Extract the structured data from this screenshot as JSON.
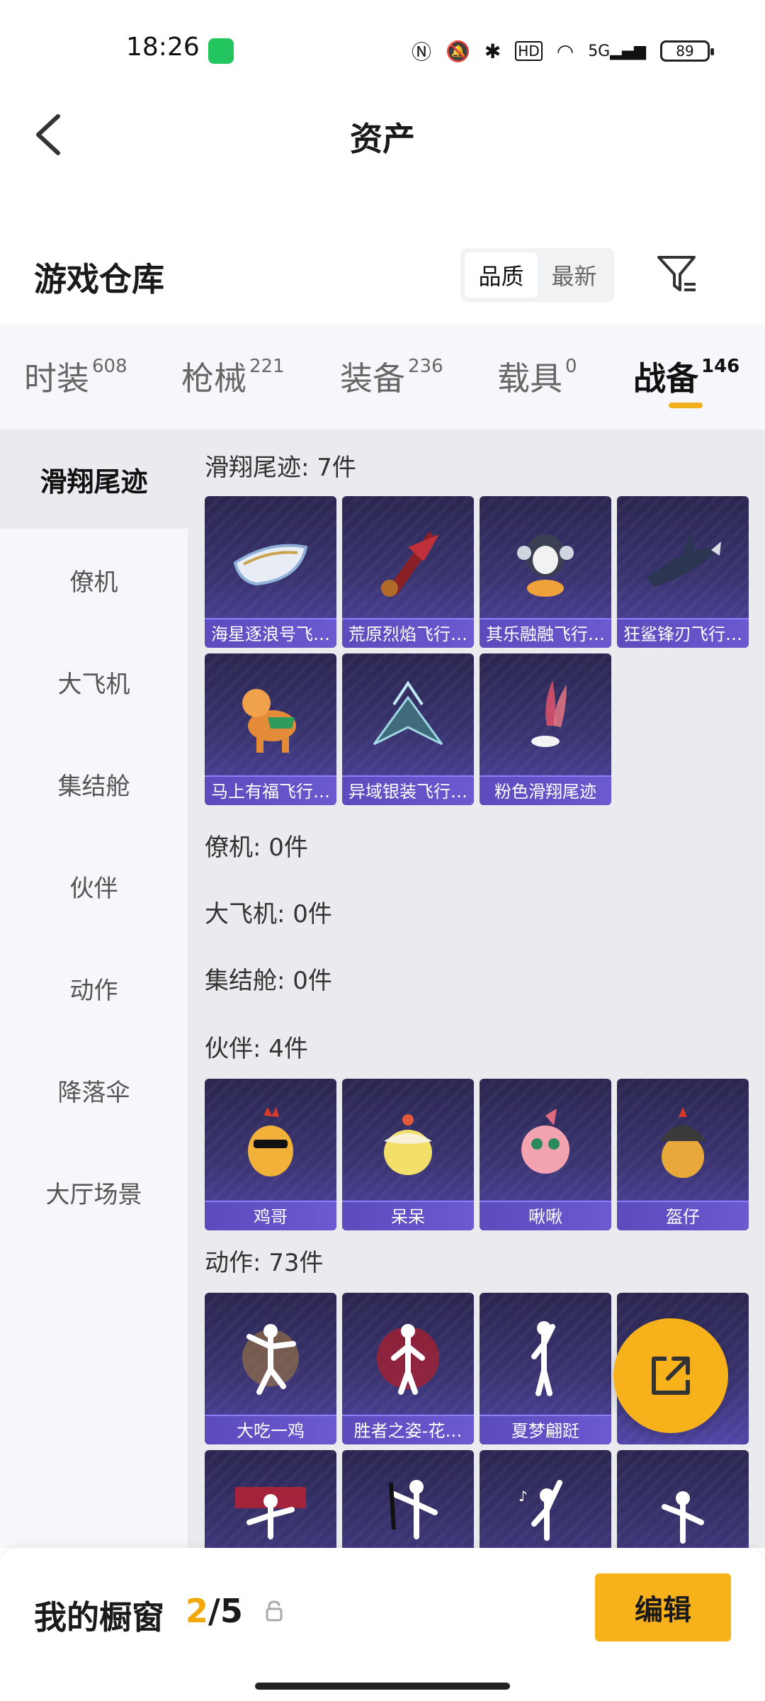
{
  "status_bar": {
    "time": "18:26",
    "battery": "89",
    "network": "5G"
  },
  "header": {
    "title": "资产"
  },
  "warehouse": {
    "title": "游戏仓库",
    "sort_options": [
      "品质",
      "最新"
    ],
    "active_sort": "品质"
  },
  "category_tabs": [
    {
      "label": "时装",
      "count": "608"
    },
    {
      "label": "枪械",
      "count": "221"
    },
    {
      "label": "装备",
      "count": "236"
    },
    {
      "label": "载具",
      "count": "0"
    },
    {
      "label": "战备",
      "count": "146"
    }
  ],
  "active_category": "战备",
  "side_nav": [
    "滑翔尾迹",
    "僚机",
    "大飞机",
    "集结舱",
    "伙伴",
    "动作",
    "降落伞",
    "大厅场景"
  ],
  "sections": {
    "glide": {
      "title": "滑翔尾迹: 7件",
      "items": [
        "海星逐浪号飞…",
        "荒原烈焰飞行…",
        "其乐融融飞行…",
        "狂鲨锋刃飞行…",
        "马上有福飞行…",
        "异域银装飞行…",
        "粉色滑翔尾迹"
      ]
    },
    "wingman": {
      "title": "僚机: 0件"
    },
    "plane": {
      "title": "大飞机: 0件"
    },
    "pod": {
      "title": "集结舱: 0件"
    },
    "partner": {
      "title": "伙伴: 4件",
      "items": [
        "鸡哥",
        "呆呆",
        "啾啾",
        "盔仔"
      ]
    },
    "emote": {
      "title": "动作: 73件",
      "items": [
        "大吃一鸡",
        "胜者之姿-花…",
        "夏梦翩跹"
      ]
    }
  },
  "bottom_bar": {
    "label": "我的橱窗",
    "current": "2",
    "sep_total": "/5",
    "edit_label": "编辑"
  }
}
